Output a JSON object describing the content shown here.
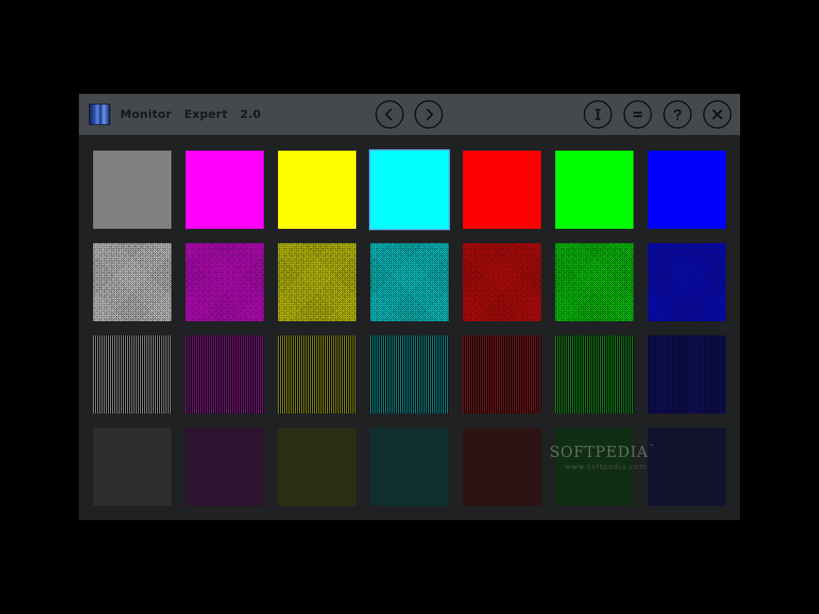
{
  "window": {
    "title": "Monitor  Expert  2.0"
  },
  "toolbar": {
    "nav_buttons": [
      {
        "name": "previous-button",
        "icon": "chevron-left-icon"
      },
      {
        "name": "next-button",
        "icon": "chevron-right-icon"
      }
    ],
    "action_buttons": [
      {
        "name": "info-button",
        "icon": "info-icon"
      },
      {
        "name": "menu-button",
        "icon": "equals-icon"
      },
      {
        "name": "help-button",
        "icon": "question-icon"
      },
      {
        "name": "close-button",
        "icon": "close-icon"
      }
    ]
  },
  "palette": {
    "columns": [
      {
        "name": "gray",
        "solid": "#808080",
        "hue": "#ffffff"
      },
      {
        "name": "magenta",
        "solid": "#ff00ff",
        "hue": "#ff00ff"
      },
      {
        "name": "yellow",
        "solid": "#ffff00",
        "hue": "#ffff00"
      },
      {
        "name": "cyan",
        "solid": "#00ffff",
        "hue": "#00ffff"
      },
      {
        "name": "red",
        "solid": "#ff0000",
        "hue": "#ff0000"
      },
      {
        "name": "green",
        "solid": "#00ff00",
        "hue": "#00ff00"
      },
      {
        "name": "blue",
        "solid": "#0000ff",
        "hue": "#0000ff"
      }
    ],
    "rows": [
      "solid",
      "checker",
      "vertical-lines",
      "fine-dots"
    ],
    "selected": {
      "row": 0,
      "column": 3
    },
    "selection_color": "#5aa2e6"
  },
  "watermark": {
    "text": "SOFTPEDIA",
    "trademark": "™",
    "subtext": "www.softpedia.com"
  }
}
